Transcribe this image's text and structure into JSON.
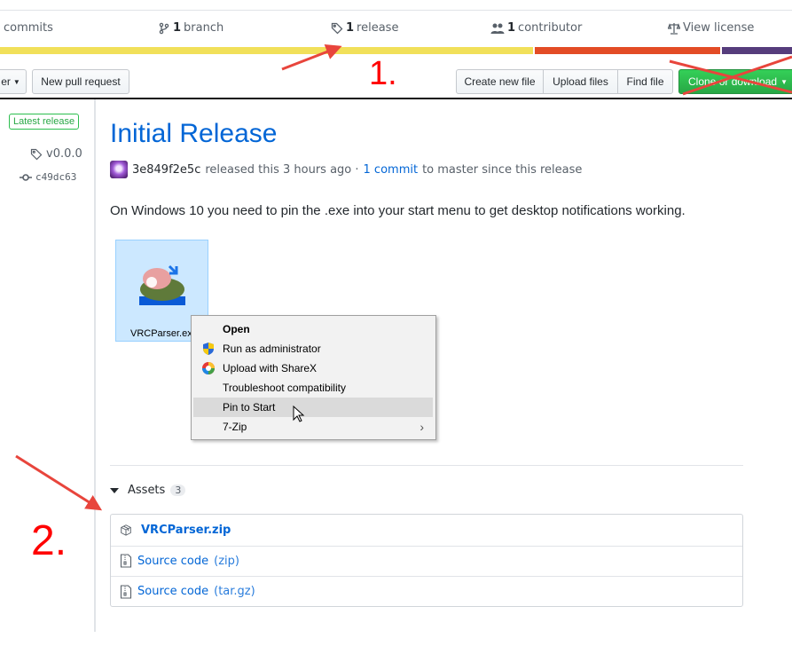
{
  "summary": {
    "commits_label": "commits",
    "branch_count": "1",
    "branch_label": "branch",
    "release_count": "1",
    "release_label": "release",
    "contributor_count": "1",
    "contributor_label": "contributor",
    "license_label": "View license"
  },
  "language_bar": [
    {
      "color": "#f1e05a",
      "share": 0.673
    },
    {
      "color": "#e34c26",
      "share": 0.236
    },
    {
      "color": "#563d7c",
      "share": 0.091
    }
  ],
  "toolbar": {
    "branch_fragment": "er",
    "new_pull_request": "New pull request",
    "create_new_file": "Create new file",
    "upload_files": "Upload files",
    "find_file": "Find file",
    "clone_or_download": "Clone or download"
  },
  "sidebar": {
    "latest_badge": "Latest release",
    "tag": "v0.0.0",
    "commit": "c49dc63"
  },
  "release": {
    "title": "Initial Release",
    "author": "3e849f2e5c",
    "released_text": "released this 3 hours ago ·",
    "commits_link": "1 commit",
    "commits_suffix": "to master since this release",
    "description": "On Windows 10 you need to pin the .exe into your start menu to get desktop notifications working."
  },
  "explorer_file": {
    "name": "VRCParser.exe"
  },
  "context_menu": {
    "items": [
      {
        "label": "Open",
        "icon": "",
        "bold": true
      },
      {
        "label": "Run as administrator",
        "icon": "uac-shield-icon"
      },
      {
        "label": "Upload with ShareX",
        "icon": "sharex-icon"
      },
      {
        "label": "Troubleshoot compatibility",
        "icon": ""
      },
      {
        "label": "Pin to Start",
        "icon": "",
        "hover": true
      },
      {
        "label": "7-Zip",
        "icon": "",
        "submenu": true
      }
    ]
  },
  "assets": {
    "heading": "Assets",
    "count": "3",
    "items": [
      {
        "name": "VRCParser.zip",
        "suffix": "",
        "icon": "package-icon"
      },
      {
        "name": "Source code",
        "suffix": "(zip)",
        "icon": "file-zip-icon"
      },
      {
        "name": "Source code",
        "suffix": "(tar.gz)",
        "icon": "file-zip-icon"
      }
    ]
  },
  "annotations": {
    "step1": "1.",
    "step2": "2."
  }
}
